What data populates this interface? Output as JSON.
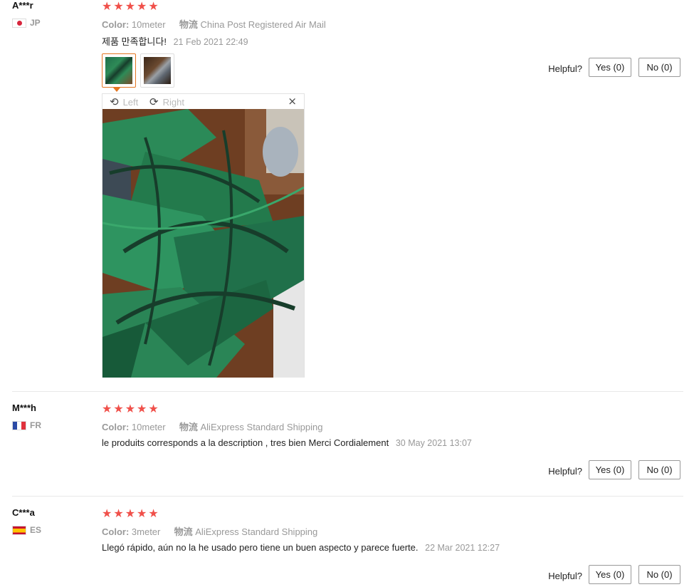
{
  "reviews": [
    {
      "user": "A***r",
      "country": "JP",
      "rating": 5,
      "color_label": "Color:",
      "color_value": "10meter",
      "shipping_label": "物流",
      "shipping_value": "China Post Registered Air Mail",
      "text": "제품 만족합니다!",
      "date": "21 Feb 2021 22:49",
      "helpful_label": "Helpful?",
      "yes_label": "Yes (0)",
      "no_label": "No (0)",
      "photos": [
        "photo-1",
        "photo-2"
      ],
      "viewer": {
        "left_label": "Left",
        "right_label": "Right",
        "close_symbol": "×"
      }
    },
    {
      "user": "M***h",
      "country": "FR",
      "rating": 5,
      "color_label": "Color:",
      "color_value": "10meter",
      "shipping_label": "物流",
      "shipping_value": "AliExpress Standard Shipping",
      "text": "le produits corresponds a la description , tres bien Merci Cordialement",
      "date": "30 May 2021 13:07",
      "helpful_label": "Helpful?",
      "yes_label": "Yes (0)",
      "no_label": "No (0)"
    },
    {
      "user": "C***a",
      "country": "ES",
      "rating": 5,
      "color_label": "Color:",
      "color_value": "3meter",
      "shipping_label": "物流",
      "shipping_value": "AliExpress Standard Shipping",
      "text": "Llegó rápido, aún no la he usado pero tiene un buen aspecto y parece fuerte.",
      "date": "22 Mar 2021 12:27",
      "helpful_label": "Helpful?",
      "yes_label": "Yes (0)",
      "no_label": "No (0)"
    }
  ],
  "colors": {
    "star": "#f0504a",
    "active_thumb": "#e47622",
    "meta_text": "#999999"
  },
  "icons": {
    "star": "star-icon",
    "rotate_left": "rotate-left-icon",
    "rotate_right": "rotate-right-icon",
    "close": "close-icon"
  }
}
